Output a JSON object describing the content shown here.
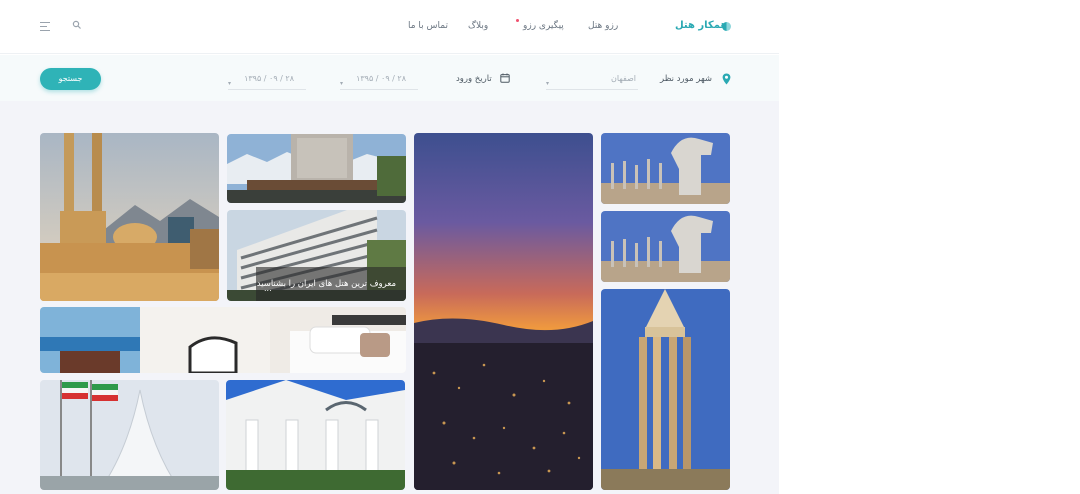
{
  "header": {
    "brand": "همکار هتل",
    "nav": [
      {
        "label": "رزو هتل"
      },
      {
        "label": "پیگیری رزو"
      },
      {
        "label": "وبلاگ"
      },
      {
        "label": "تماس با ما"
      }
    ]
  },
  "search": {
    "city_label": "شهر مورد نظر",
    "city_value": "اصفهان",
    "checkin_label": "تاریخ ورود",
    "date_1": "۱۳۹۵ / ۰۹ / ۲۸",
    "date_2": "۱۳۹۵ / ۰۹ / ۲۸",
    "submit_label": "جستجو"
  },
  "gallery": {
    "caption": "معروف ترین هتل های ایران را بشناسید",
    "caption_ellipsis": "..."
  },
  "colors": {
    "accent": "#2fb3b7",
    "notification_dot": "#f0506e",
    "gallery_background": "#f3f4f9"
  },
  "icons": [
    "menu-icon",
    "search-icon",
    "location-pin-icon",
    "calendar-icon",
    "logo-icon"
  ]
}
